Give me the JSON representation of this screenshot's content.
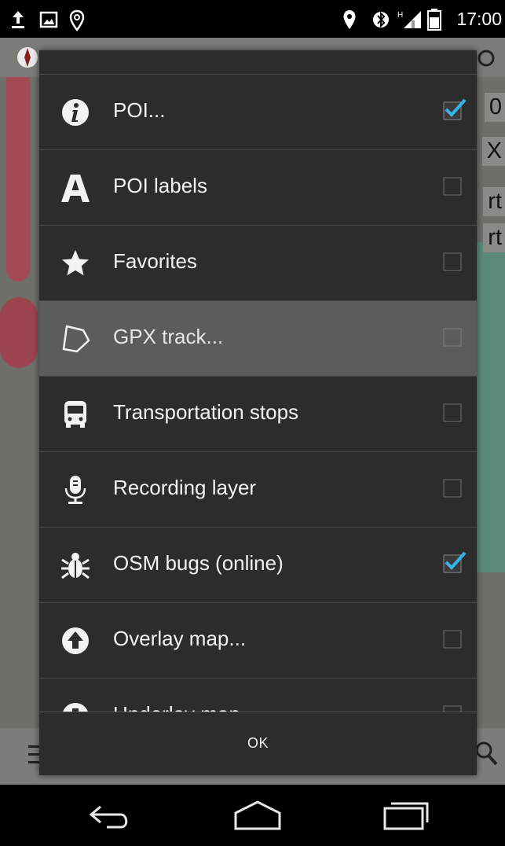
{
  "status_bar": {
    "time": "17:00",
    "left_icons": [
      "upload-icon",
      "image-icon",
      "location-pin-outline-icon"
    ],
    "right_icons": [
      "location-pin-icon",
      "bluetooth-icon",
      "signal-icon",
      "battery-icon"
    ]
  },
  "map_background": {
    "labels": [
      "0",
      "X",
      "rt",
      "rt"
    ]
  },
  "dialog": {
    "items": [
      {
        "label": "POI...",
        "icon": "info-icon",
        "checked": true
      },
      {
        "label": "POI labels",
        "icon": "letter-a-icon",
        "checked": false
      },
      {
        "label": "Favorites",
        "icon": "star-icon",
        "checked": false
      },
      {
        "label": "GPX track...",
        "icon": "polygon-track-icon",
        "checked": false,
        "highlighted": true
      },
      {
        "label": "Transportation stops",
        "icon": "bus-icon",
        "checked": false
      },
      {
        "label": "Recording layer",
        "icon": "microphone-icon",
        "checked": false
      },
      {
        "label": "OSM bugs (online)",
        "icon": "bug-icon",
        "checked": true
      },
      {
        "label": "Overlay map...",
        "icon": "arrow-up-circle-icon",
        "checked": false
      },
      {
        "label": "Underlay map...",
        "icon": "arrow-down-circle-icon",
        "checked": false
      }
    ],
    "ok_label": "OK"
  },
  "nav_bar": {
    "buttons": [
      "back-icon",
      "home-icon",
      "recent-apps-icon"
    ]
  },
  "colors": {
    "accent": "#33b5e5",
    "dialog_bg": "#2c2c2c",
    "highlight_bg": "#5c5c5c"
  }
}
